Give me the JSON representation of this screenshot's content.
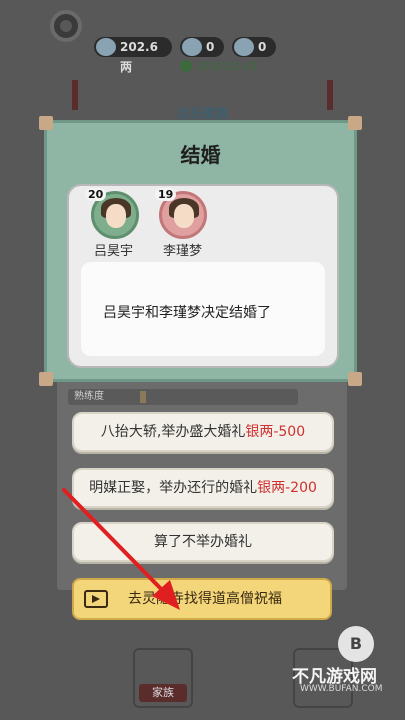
{
  "resources": {
    "silver": "202.6两",
    "item_b": "0",
    "item_c": "0",
    "timer": "1000.02.01"
  },
  "clan_title": "吕氏家族",
  "dialog": {
    "title": "结婚",
    "groom": {
      "name": "吕昊宇",
      "age": "20"
    },
    "bride": {
      "name": "李瑾梦",
      "age": "19"
    },
    "message": "吕昊宇和李瑾梦决定结婚了"
  },
  "skill_bar_label": "熟练度",
  "options": [
    {
      "text": "八抬大轿,举办盛大婚礼",
      "cost": "银两-500"
    },
    {
      "text": "明媒正娶，举办还行的婚礼",
      "cost": "银两-200"
    },
    {
      "text": "算了不举办婚礼",
      "cost": ""
    }
  ],
  "video_button": "去灵隐寺找得道高僧祝福",
  "nav": {
    "family_label": "家族"
  },
  "watermark": {
    "text": "不凡游戏网",
    "url": "WWW.BUFAN.COM"
  },
  "colors": {
    "dialog_bg": "#8fb5a5",
    "cost_red": "#d03030",
    "video_btn": "#f3d57a",
    "arrow": "#e02020"
  }
}
